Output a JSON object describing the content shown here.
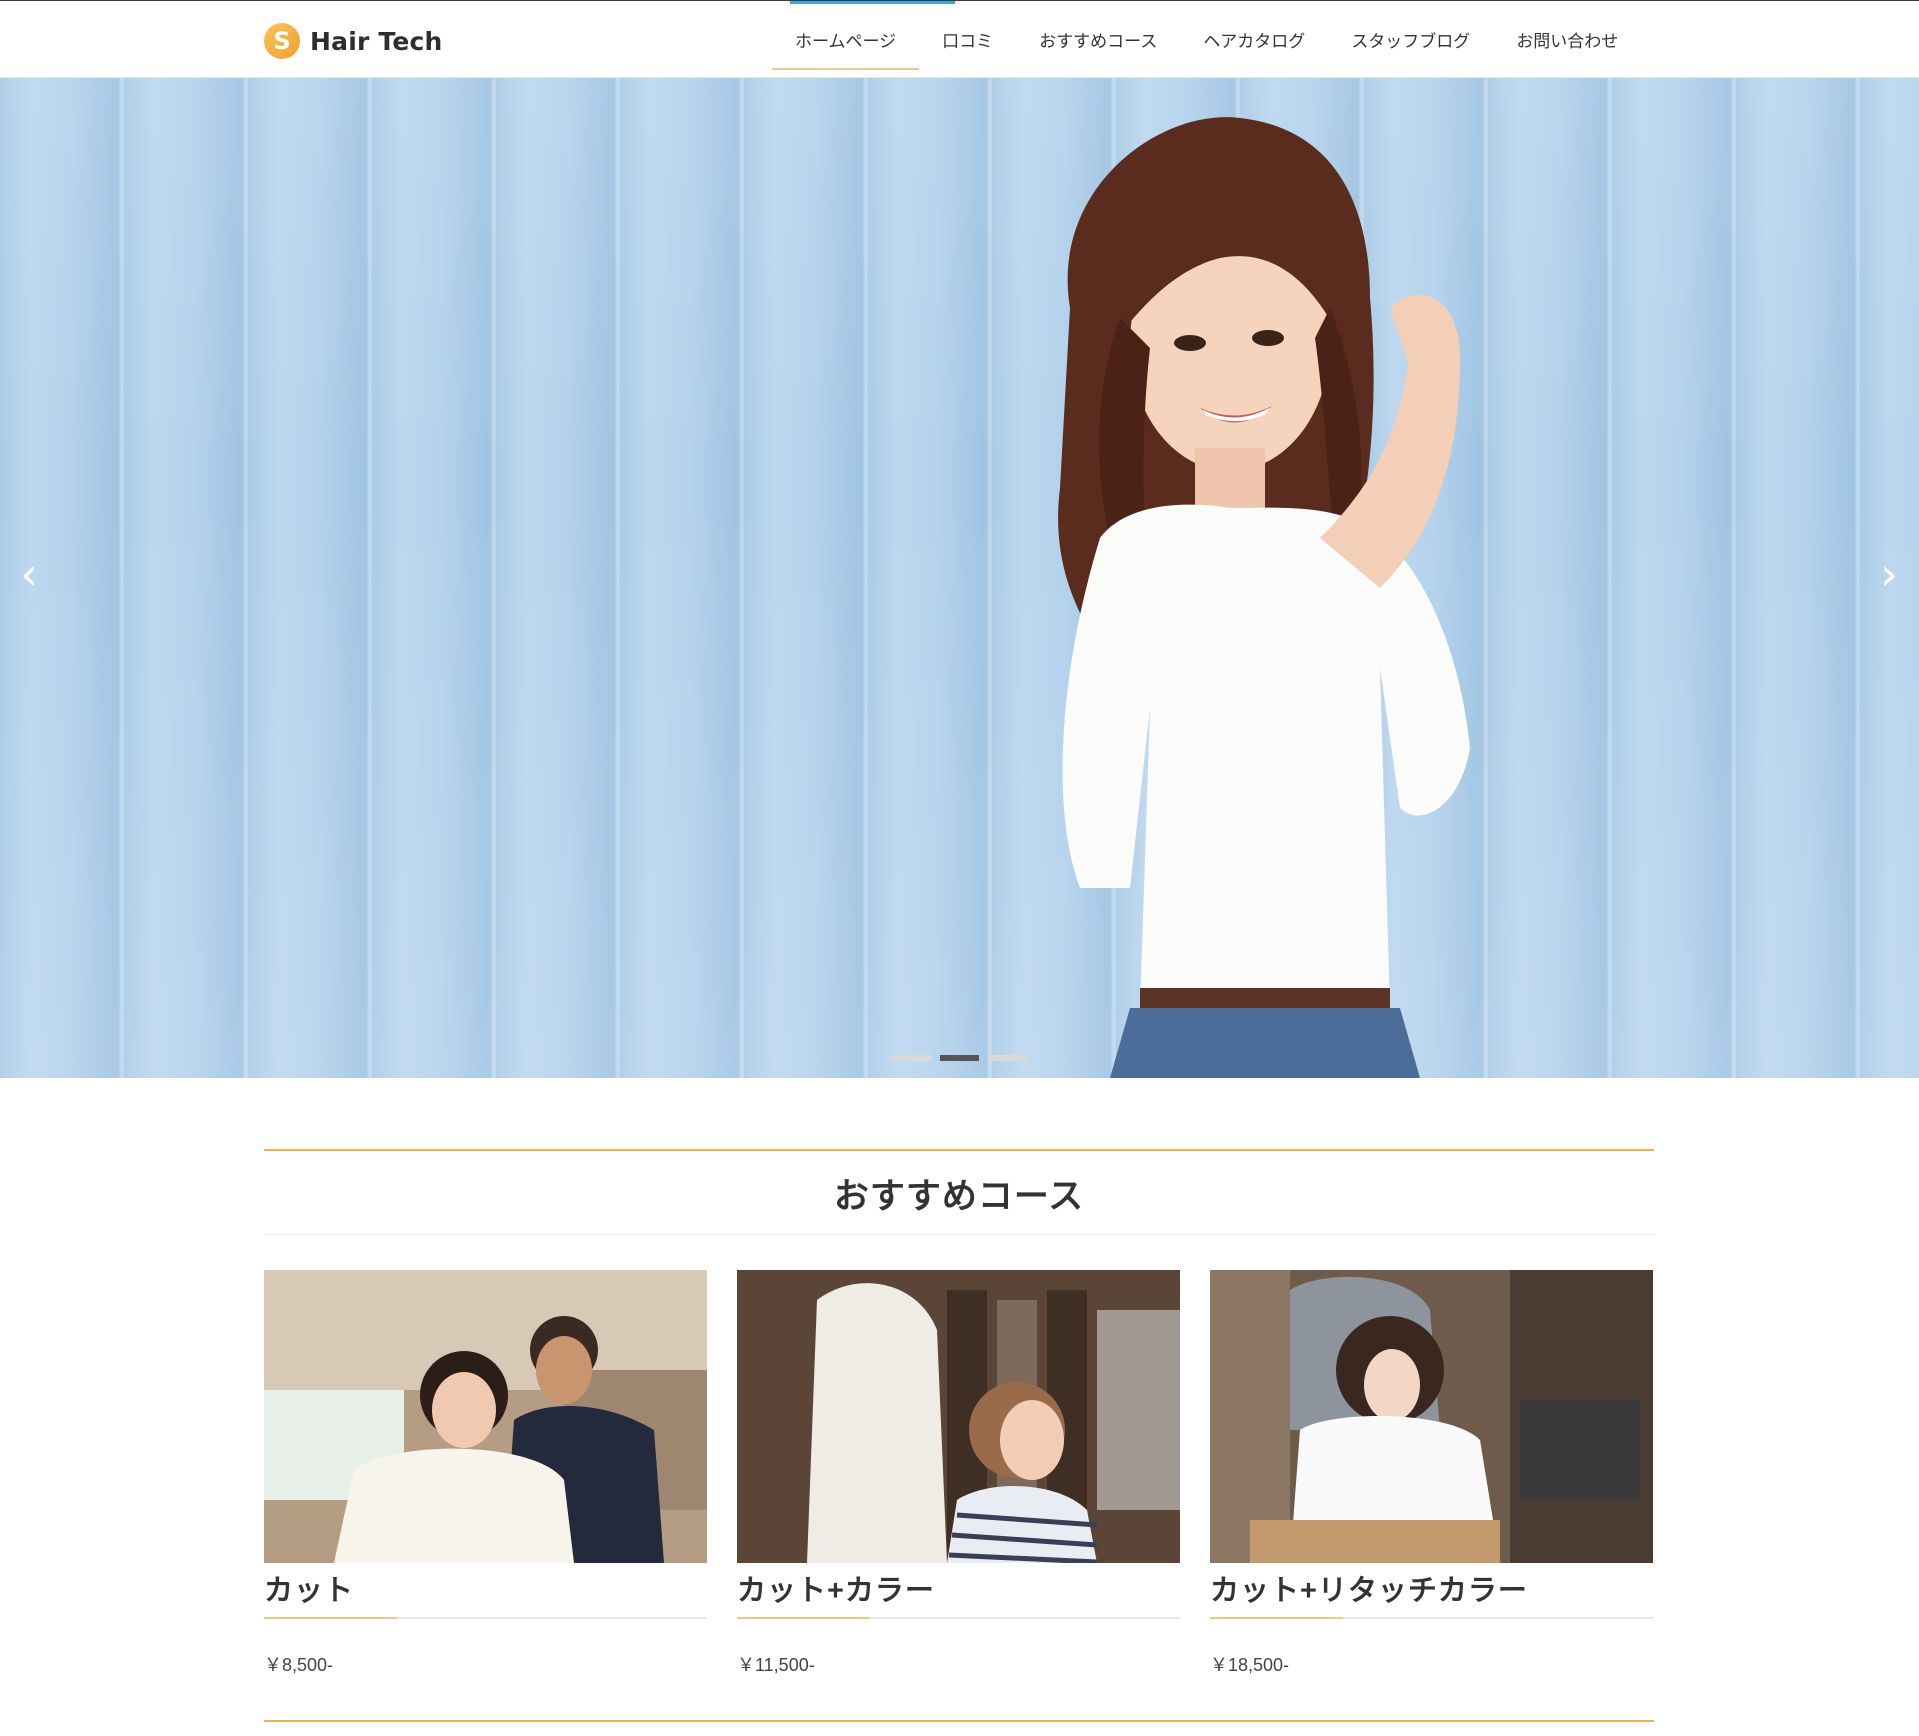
{
  "header": {
    "logo_text": "Hair Tech",
    "logo_icon": "S-logo-icon",
    "nav": [
      {
        "label": "ホームページ",
        "active": true
      },
      {
        "label": "口コミ"
      },
      {
        "label": "おすすめコース"
      },
      {
        "label": "ヘアカタログ"
      },
      {
        "label": "スタッフブログ"
      },
      {
        "label": "お問い合わせ"
      }
    ]
  },
  "hero": {
    "prev_icon": "chevron-left-icon",
    "next_icon": "chevron-right-icon",
    "slides_total": 3,
    "active_slide": 2
  },
  "courses": {
    "title": "おすすめコース",
    "items": [
      {
        "name": "カット",
        "price": "￥8,500-"
      },
      {
        "name": "カット+カラー",
        "price": "￥11,500-"
      },
      {
        "name": "カット+リタッチカラー",
        "price": "￥18,500-"
      }
    ]
  },
  "colors": {
    "accent_orange": "#f0b24e",
    "accent_gold": "#e8c98e",
    "hero_sky": "#b3d2ec"
  }
}
